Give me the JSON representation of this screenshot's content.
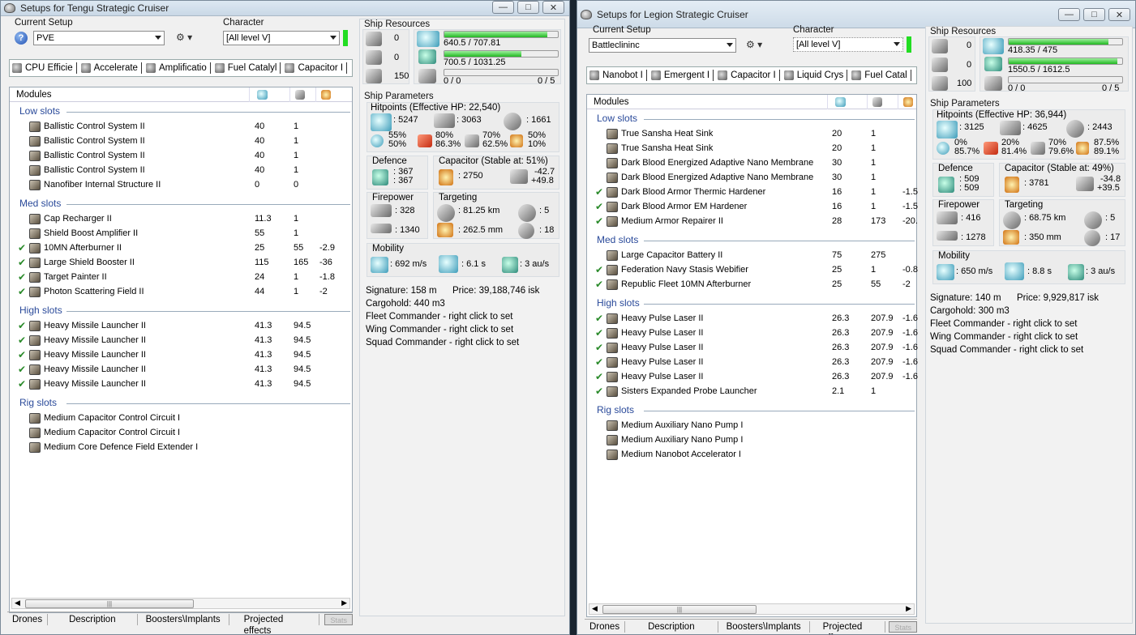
{
  "windows": [
    {
      "title": "Setups for Tengu Strategic Cruiser",
      "current_setup_label": "Current Setup",
      "current_setup_value": "PVE",
      "character_label": "Character",
      "character_value": "[All level V]",
      "tabs": [
        "CPU Efficie",
        "Accelerate",
        "Amplificatio",
        "Fuel Catalyl",
        "Capacitor I"
      ],
      "modules_header": "Modules",
      "groups": [
        {
          "title": "Low slots",
          "rows": [
            {
              "checked": false,
              "name": "Ballistic Control System II",
              "c1": "40",
              "c2": "1",
              "c3": ""
            },
            {
              "checked": false,
              "name": "Ballistic Control System II",
              "c1": "40",
              "c2": "1",
              "c3": ""
            },
            {
              "checked": false,
              "name": "Ballistic Control System II",
              "c1": "40",
              "c2": "1",
              "c3": ""
            },
            {
              "checked": false,
              "name": "Ballistic Control System II",
              "c1": "40",
              "c2": "1",
              "c3": ""
            },
            {
              "checked": false,
              "name": "Nanofiber Internal Structure II",
              "c1": "0",
              "c2": "0",
              "c3": ""
            }
          ]
        },
        {
          "title": "Med slots",
          "rows": [
            {
              "checked": false,
              "name": "Cap Recharger II",
              "c1": "11.3",
              "c2": "1",
              "c3": ""
            },
            {
              "checked": false,
              "name": "Shield Boost Amplifier II",
              "c1": "55",
              "c2": "1",
              "c3": ""
            },
            {
              "checked": true,
              "name": "10MN Afterburner II",
              "c1": "25",
              "c2": "55",
              "c3": "-2.9"
            },
            {
              "checked": true,
              "name": "Large Shield Booster II",
              "c1": "115",
              "c2": "165",
              "c3": "-36"
            },
            {
              "checked": true,
              "name": "Target Painter II",
              "c1": "24",
              "c2": "1",
              "c3": "-1.8"
            },
            {
              "checked": true,
              "name": "Photon Scattering Field II",
              "c1": "44",
              "c2": "1",
              "c3": "-2"
            }
          ]
        },
        {
          "title": "High slots",
          "rows": [
            {
              "checked": true,
              "name": "Heavy Missile Launcher II",
              "c1": "41.3",
              "c2": "94.5",
              "c3": ""
            },
            {
              "checked": true,
              "name": "Heavy Missile Launcher II",
              "c1": "41.3",
              "c2": "94.5",
              "c3": ""
            },
            {
              "checked": true,
              "name": "Heavy Missile Launcher II",
              "c1": "41.3",
              "c2": "94.5",
              "c3": ""
            },
            {
              "checked": true,
              "name": "Heavy Missile Launcher II",
              "c1": "41.3",
              "c2": "94.5",
              "c3": ""
            },
            {
              "checked": true,
              "name": "Heavy Missile Launcher II",
              "c1": "41.3",
              "c2": "94.5",
              "c3": ""
            }
          ]
        },
        {
          "title": "Rig slots",
          "rows": [
            {
              "checked": false,
              "name": "Medium Capacitor Control Circuit I",
              "c1": "",
              "c2": "",
              "c3": ""
            },
            {
              "checked": false,
              "name": "Medium Capacitor Control Circuit I",
              "c1": "",
              "c2": "",
              "c3": ""
            },
            {
              "checked": false,
              "name": "Medium Core Defence Field Extender I",
              "c1": "",
              "c2": "",
              "c3": ""
            }
          ]
        }
      ],
      "bottom_tabs": [
        "Drones",
        "Description",
        "Boosters\\Implants",
        "Projected effects",
        "Stats"
      ],
      "resources": {
        "title": "Ship Resources",
        "hardpoints": [
          "0",
          "0",
          "150"
        ],
        "cpu": "640.5 / 707.81",
        "cpu_fraction": 0.905,
        "power": "700.5 / 1031.25",
        "power_fraction": 0.679,
        "calib": "0 / 0",
        "calib_right": "0 / 5",
        "calib_fraction": 0
      },
      "params": {
        "title": "Ship Parameters",
        "hp_title": "Hitpoints (Effective HP: 22,540)",
        "shield": ": 5247",
        "armor": ": 3063",
        "hull": ": 1661",
        "res_em": "55%\n50%",
        "res_th": "80%\n86.3%",
        "res_kin": "70%\n62.5%",
        "res_exp": "50%\n10%",
        "defence_title": "Defence",
        "defence_a": ": 367",
        "defence_b": ": 367",
        "cap_title": "Capacitor (Stable at: 51%)",
        "cap_value": ": 2750",
        "cap_a": "-42.7",
        "cap_b": "+49.8",
        "fp_title": "Firepower",
        "fp_a": ": 328",
        "fp_b": ": 1340",
        "tg_title": "Targeting",
        "tg_range": ": 81.25 km",
        "tg_targets": ": 5",
        "tg_scan": ": 262.5 mm",
        "tg_sensor": ": 18",
        "mob_title": "Mobility",
        "mob_speed": ": 692 m/s",
        "mob_align": ": 6.1 s",
        "mob_warp": ": 3 au/s",
        "signature": "Signature: 158 m",
        "price": "Price: 39,188,746 isk",
        "cargohold": "Cargohold: 440 m3",
        "fleet": "Fleet Commander - right click to set",
        "wing": "Wing Commander - right click to set",
        "squad": "Squad Commander - right click to set"
      }
    },
    {
      "title": "Setups for Legion Strategic Cruiser",
      "current_setup_label": "Current Setup",
      "current_setup_value": "Battleclininc",
      "character_label": "Character",
      "character_value": "[All level V]",
      "tabs": [
        "Nanobot I",
        "Emergent I",
        "Capacitor I",
        "Liquid Crys",
        "Fuel Catal"
      ],
      "modules_header": "Modules",
      "groups": [
        {
          "title": "Low slots",
          "rows": [
            {
              "checked": false,
              "name": "True Sansha Heat Sink",
              "c1": "20",
              "c2": "1",
              "c3": ""
            },
            {
              "checked": false,
              "name": "True Sansha Heat Sink",
              "c1": "20",
              "c2": "1",
              "c3": ""
            },
            {
              "checked": false,
              "name": "Dark Blood Energized Adaptive Nano Membrane",
              "c1": "30",
              "c2": "1",
              "c3": ""
            },
            {
              "checked": false,
              "name": "Dark Blood Energized Adaptive Nano Membrane",
              "c1": "30",
              "c2": "1",
              "c3": ""
            },
            {
              "checked": true,
              "name": "Dark Blood Armor Thermic Hardener",
              "c1": "16",
              "c2": "1",
              "c3": "-1.5"
            },
            {
              "checked": true,
              "name": "Dark Blood Armor EM Hardener",
              "c1": "16",
              "c2": "1",
              "c3": "-1.5"
            },
            {
              "checked": true,
              "name": "Medium Armor Repairer II",
              "c1": "28",
              "c2": "173",
              "c3": "-20."
            }
          ]
        },
        {
          "title": "Med slots",
          "rows": [
            {
              "checked": false,
              "name": "Large Capacitor Battery II",
              "c1": "75",
              "c2": "275",
              "c3": ""
            },
            {
              "checked": true,
              "name": "Federation Navy Stasis Webifier",
              "c1": "25",
              "c2": "1",
              "c3": "-0.8"
            },
            {
              "checked": true,
              "name": "Republic Fleet 10MN Afterburner",
              "c1": "25",
              "c2": "55",
              "c3": "-2"
            }
          ]
        },
        {
          "title": "High slots",
          "rows": [
            {
              "checked": true,
              "name": "Heavy Pulse Laser II",
              "c1": "26.3",
              "c2": "207.9",
              "c3": "-1.6"
            },
            {
              "checked": true,
              "name": "Heavy Pulse Laser II",
              "c1": "26.3",
              "c2": "207.9",
              "c3": "-1.6"
            },
            {
              "checked": true,
              "name": "Heavy Pulse Laser II",
              "c1": "26.3",
              "c2": "207.9",
              "c3": "-1.6"
            },
            {
              "checked": true,
              "name": "Heavy Pulse Laser II",
              "c1": "26.3",
              "c2": "207.9",
              "c3": "-1.6"
            },
            {
              "checked": true,
              "name": "Heavy Pulse Laser II",
              "c1": "26.3",
              "c2": "207.9",
              "c3": "-1.6"
            },
            {
              "checked": true,
              "name": "Sisters Expanded Probe Launcher",
              "c1": "2.1",
              "c2": "1",
              "c3": ""
            }
          ]
        },
        {
          "title": "Rig slots",
          "rows": [
            {
              "checked": false,
              "name": "Medium Auxiliary Nano Pump I",
              "c1": "",
              "c2": "",
              "c3": ""
            },
            {
              "checked": false,
              "name": "Medium Auxiliary Nano Pump I",
              "c1": "",
              "c2": "",
              "c3": ""
            },
            {
              "checked": false,
              "name": "Medium Nanobot Accelerator I",
              "c1": "",
              "c2": "",
              "c3": ""
            }
          ]
        }
      ],
      "bottom_tabs": [
        "Drones",
        "Description",
        "Boosters\\Implants",
        "Projected effects",
        "Stats"
      ],
      "resources": {
        "title": "Ship Resources",
        "hardpoints": [
          "0",
          "0",
          "100"
        ],
        "cpu": "418.35 / 475",
        "cpu_fraction": 0.88,
        "power": "1550.5 / 1612.5",
        "power_fraction": 0.96,
        "calib": "0 / 0",
        "calib_right": "0 / 5",
        "calib_fraction": 0
      },
      "params": {
        "title": "Ship Parameters",
        "hp_title": "Hitpoints (Effective HP: 36,944)",
        "shield": ": 3125",
        "armor": ": 4625",
        "hull": ": 2443",
        "res_em": "0%\n85.7%",
        "res_th": "20%\n81.4%",
        "res_kin": "70%\n79.6%",
        "res_exp": "87.5%\n89.1%",
        "defence_title": "Defence",
        "defence_a": ": 509",
        "defence_b": ": 509",
        "cap_title": "Capacitor (Stable at: 49%)",
        "cap_value": ": 3781",
        "cap_a": "-34.8",
        "cap_b": "+39.5",
        "fp_title": "Firepower",
        "fp_a": ": 416",
        "fp_b": ": 1278",
        "tg_title": "Targeting",
        "tg_range": ": 68.75 km",
        "tg_targets": ": 5",
        "tg_scan": ": 350 mm",
        "tg_sensor": ": 17",
        "mob_title": "Mobility",
        "mob_speed": ": 650 m/s",
        "mob_align": ": 8.8 s",
        "mob_warp": ": 3 au/s",
        "signature": "Signature: 140 m",
        "price": "Price: 9,929,817 isk",
        "cargohold": "Cargohold: 300 m3",
        "fleet": "Fleet Commander - right click to set",
        "wing": "Wing Commander - right click to set",
        "squad": "Squad Commander - right click to set"
      }
    }
  ],
  "colors": {
    "group_title": "#2a4a9a",
    "check": "#2a8a2a",
    "bar_fill": "#22b822",
    "close_button": "#c2462e"
  }
}
